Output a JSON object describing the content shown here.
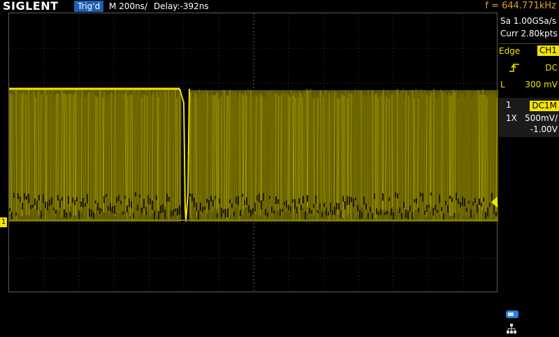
{
  "topbar": {
    "brand": "SIGLENT",
    "trig_status": "Trig'd",
    "timebase": "M 200ns/",
    "delay": "Delay:-392ns",
    "frequency": "f = 644.771kHz"
  },
  "acquisition": {
    "sample_rate": "Sa 1.00GSa/s",
    "memory": "Curr 2.80kpts"
  },
  "trigger": {
    "type": "Edge",
    "source": "CH1",
    "slope_icon": "rising-edge-icon",
    "coupling": "DC",
    "level_label": "L",
    "level": "300 mV"
  },
  "channel1": {
    "number": "1",
    "coupling": "DC1M",
    "probe": "1X",
    "scale": "500mV/",
    "offset": "-1.00V",
    "marker": "1"
  },
  "colors": {
    "trace": "#f2e300",
    "trigger_marker": "#1e8fe8",
    "trig_badge": "#1d5fb5",
    "frequency_text": "#e0a030"
  },
  "status_icons": [
    "usb-icon",
    "network-icon"
  ]
}
